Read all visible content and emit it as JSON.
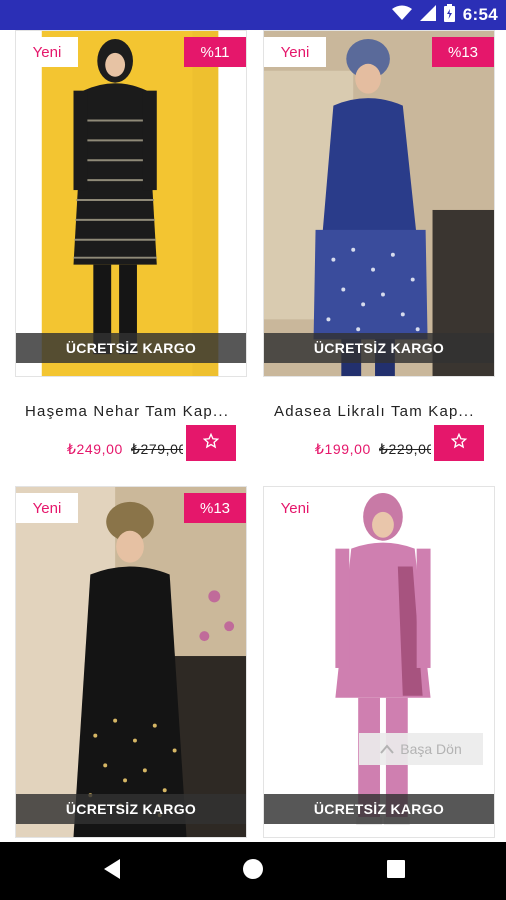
{
  "status_bar": {
    "time": "6:54",
    "icons": [
      "wifi-icon",
      "signal-icon",
      "battery-icon"
    ]
  },
  "colors": {
    "status_bar": "#2b2fb6",
    "accent": "#e5176b",
    "nav_bar": "#000000"
  },
  "products": [
    {
      "new_label": "Yeni",
      "discount": "%11",
      "shipping": "ÜCRETSİZ KARGO",
      "name": "Haşema Nehar Tam Kap...",
      "price": "₺249,00",
      "old_price": "₺279,00",
      "favorite_icon": "star-icon"
    },
    {
      "new_label": "Yeni",
      "discount": "%13",
      "shipping": "ÜCRETSİZ KARGO",
      "name": "Adasea Likralı Tam Kap...",
      "price": "₺199,00",
      "old_price": "₺229,00",
      "favorite_icon": "star-icon"
    },
    {
      "new_label": "Yeni",
      "discount": "%13",
      "shipping": "ÜCRETSİZ KARGO"
    },
    {
      "new_label": "Yeni",
      "shipping": "ÜCRETSİZ KARGO"
    }
  ],
  "back_to_top": {
    "label": "Başa Dön",
    "icon": "chevron-up-icon"
  },
  "nav": {
    "back": "back-icon",
    "home": "home-icon",
    "recents": "recents-icon"
  }
}
